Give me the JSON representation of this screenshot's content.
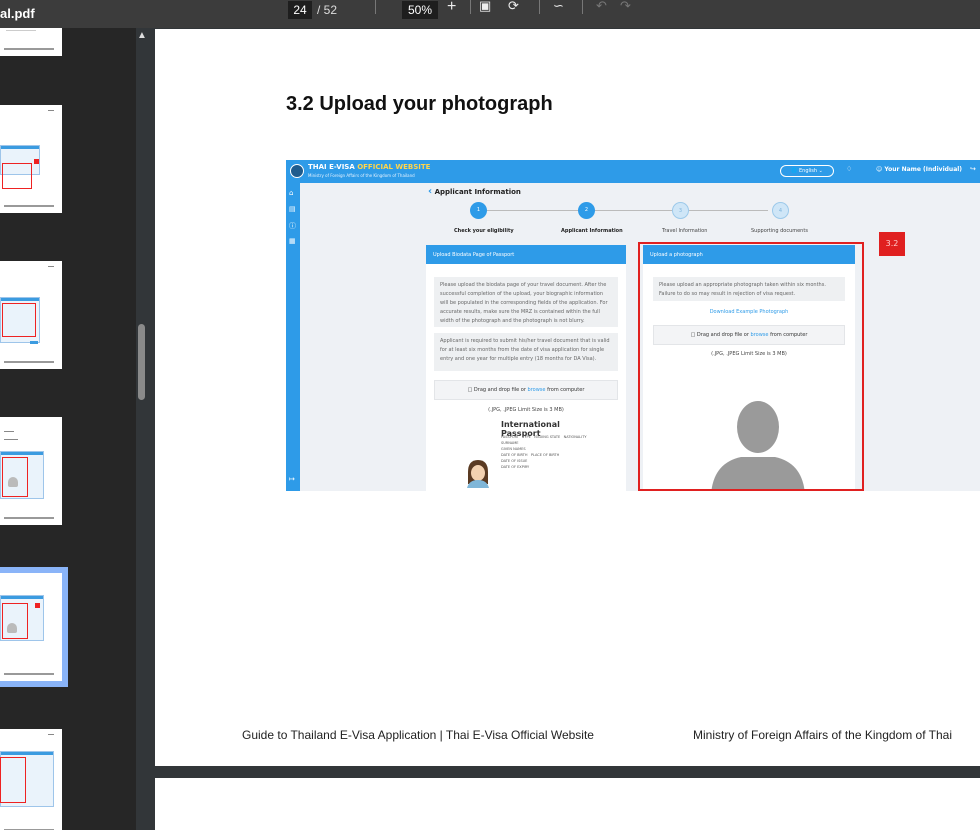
{
  "toolbar": {
    "file_name": "al.pdf",
    "page_current": "24",
    "page_total": "/ 52",
    "zoom": "50%",
    "zoom_in_label": "+",
    "icons": [
      "fit-page-icon",
      "rotate-icon",
      "draw-icon",
      "undo-icon",
      "redo-icon"
    ]
  },
  "sidebar": {
    "thumbnails": 6,
    "selected_index": 4
  },
  "document": {
    "heading": "3.2 Upload your photograph",
    "footer_left": "Guide to Thailand E-Visa Application | Thai E-Visa Official Website",
    "footer_right": "Ministry of Foreign Affairs of the Kingdom of Thai",
    "callout_label": "3.2",
    "screenshot": {
      "site_title_white": "THAI E-VISA",
      "site_title_yellow": "OFFICIAL WEBSITE",
      "site_subtitle": "Ministry of Foreign Affairs of the Kingdom of Thailand",
      "language": "English",
      "user_label": "Your Name (Individual)",
      "back_label": "Applicant Information",
      "steps": [
        {
          "num": "1",
          "label": "Check your eligibility"
        },
        {
          "num": "2",
          "label": "Applicant Information"
        },
        {
          "num": "3",
          "label": "Travel Information"
        },
        {
          "num": "4",
          "label": "Supporting documents"
        }
      ],
      "left_panel": {
        "title": "Upload Biodata Page of Passport",
        "text1": "Please upload the biodata page of your travel document. After the successful completion of the upload, your biographic information will be populated in the corresponding fields of the application. For accurate results, make sure the MRZ is contained within the full width of the photograph and the photograph is not blurry.",
        "text2": "Applicant is required to submit his/her travel document that is valid for at least six months from the date of visa application for single entry and one year for multiple entry (18 months for DA Visa).",
        "drop_prefix": "Drag and drop file or",
        "drop_link": "browse",
        "drop_suffix": "from computer",
        "limit": "(.JPG, .JPEG Limit Size is 3 MB)",
        "passport_title": "International Passport"
      },
      "right_panel": {
        "title": "Upload a photograph",
        "text": "Please upload an appropriate photograph taken within six months. Failure to do so may result in rejection of visa request.",
        "download_link": "Download Example Photograph",
        "drop_prefix": "Drag and drop file or",
        "drop_link": "browse",
        "drop_suffix": "from computer",
        "limit": "(.JPG, .JPEG Limit Size is 3 MB)"
      }
    }
  },
  "colors": {
    "accent": "#2e9be8",
    "highlight": "#e02020",
    "selection": "#8ab4f8"
  }
}
